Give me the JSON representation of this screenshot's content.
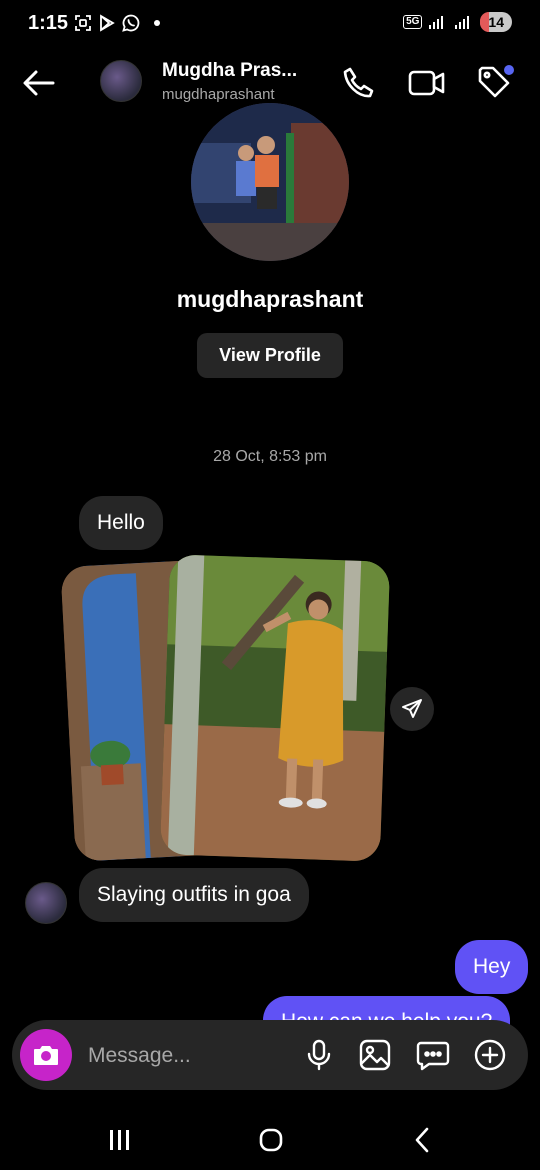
{
  "status_bar": {
    "time": "1:15",
    "network": "5G",
    "battery": "14"
  },
  "header": {
    "display_name": "Mugdha Pras...",
    "username": "mugdhaprashant"
  },
  "profile": {
    "username": "mugdhaprashant",
    "view_profile_label": "View Profile"
  },
  "thread": {
    "timestamp": "28 Oct, 8:53 pm",
    "messages": [
      {
        "from": "them",
        "text": "Hello"
      },
      {
        "from": "them",
        "text": "Slaying outfits in goa"
      },
      {
        "from": "me",
        "text": "Hey"
      },
      {
        "from": "me",
        "text": "How can we help you?"
      }
    ]
  },
  "composer": {
    "placeholder": "Message..."
  },
  "colors": {
    "accent_outgoing": "#6052f5",
    "camera_button": "#c624c9",
    "incoming_bubble": "#262626"
  }
}
